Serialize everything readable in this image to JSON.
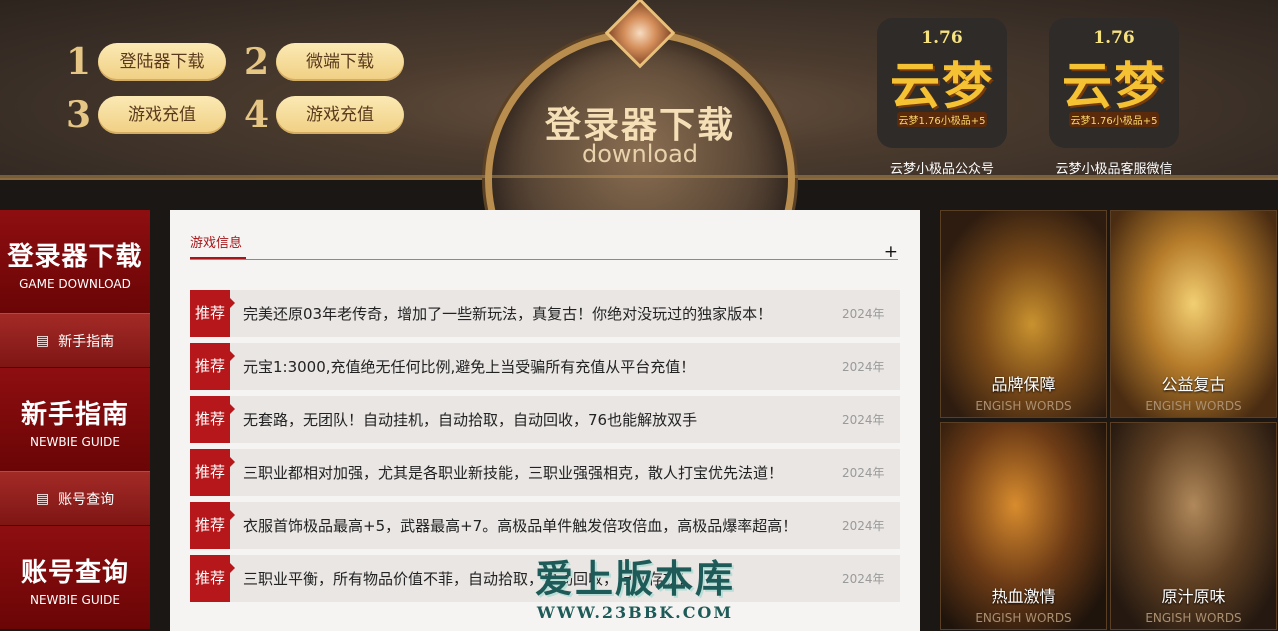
{
  "header": {
    "quick_links": [
      {
        "num": "1",
        "label": "登陆器下载"
      },
      {
        "num": "2",
        "label": "微端下载"
      },
      {
        "num": "3",
        "label": "游戏充值"
      },
      {
        "num": "4",
        "label": "游戏充值"
      }
    ],
    "emblem": {
      "title": "登录器下载",
      "subtitle": "download"
    },
    "qrcodes": [
      {
        "version": "1.76",
        "big_text": "云梦",
        "small_text": "云梦1.76小极品+5",
        "caption": "云梦小极品公众号"
      },
      {
        "version": "1.76",
        "big_text": "云梦",
        "small_text": "云梦1.76小极品+5",
        "caption": "云梦小极品客服微信"
      }
    ]
  },
  "leftnav": {
    "download": {
      "zh": "登录器下载",
      "en": "GAME DOWNLOAD"
    },
    "guide_small": "新手指南",
    "guide_big": {
      "zh": "新手指南",
      "en": "NEWBIE GUIDE"
    },
    "account_small": "账号查询",
    "account_big": {
      "zh": "账号查询",
      "en": "NEWBIE GUIDE"
    }
  },
  "news": {
    "tab": "游戏信息",
    "more": "+",
    "items": [
      {
        "tag": "推荐",
        "title": "完美还原03年老传奇，增加了一些新玩法，真复古！你绝对没玩过的独家版本！",
        "year": "2024年"
      },
      {
        "tag": "推荐",
        "title": "元宝1:3000,充值绝无任何比例,避免上当受骗所有充值从平台充值！",
        "year": "2024年"
      },
      {
        "tag": "推荐",
        "title": "无套路，无团队！自动挂机，自动拾取，自动回收，76也能解放双手",
        "year": "2024年"
      },
      {
        "tag": "推荐",
        "title": "三职业都相对加强，尤其是各职业新技能，三职业强强相克，散人打宝优先法道！",
        "year": "2024年"
      },
      {
        "tag": "推荐",
        "title": "衣服首饰极品最高+5，武器最高+7。高极品单件触发倍攻倍血，高极品爆率超高！",
        "year": "2024年"
      },
      {
        "tag": "推荐",
        "title": "三职业平衡，所有物品价值不菲，自动拾取，自动回收，自动存放！",
        "year": "2024年"
      }
    ]
  },
  "gallery": [
    {
      "label": "品牌保障",
      "sub": "ENGISH WORDS"
    },
    {
      "label": "公益复古",
      "sub": "ENGISH WORDS"
    },
    {
      "label": "热血激情",
      "sub": "ENGISH WORDS"
    },
    {
      "label": "原汁原味",
      "sub": "ENGISH WORDS"
    }
  ],
  "watermark": {
    "title": "爱上版本库",
    "url": "WWW.23BBK.COM"
  },
  "colors": {
    "accent_red": "#b5171b",
    "gold": "#f0cf82",
    "nav_red": "#8e0e10"
  }
}
